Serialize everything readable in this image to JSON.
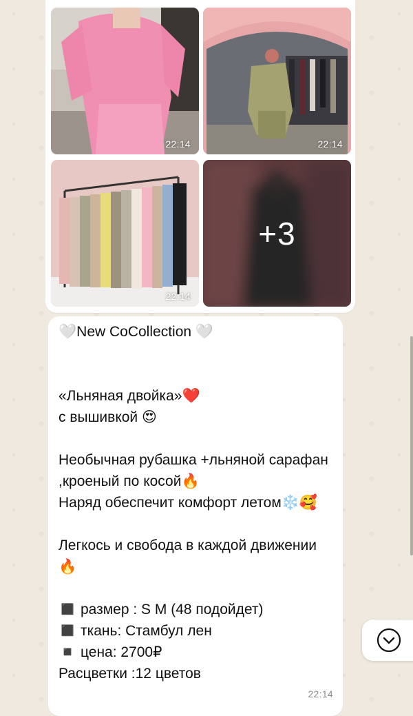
{
  "album": {
    "photos": [
      {
        "name": "pink-linen-set-photo",
        "time": "22:14"
      },
      {
        "name": "olive-linen-set-mirror-photo",
        "time": "22:14"
      },
      {
        "name": "clothing-rack-colors-photo",
        "time": "22:14"
      },
      {
        "name": "more-photos-tile",
        "time": "",
        "more": "+3"
      }
    ]
  },
  "message": {
    "text": "🤍New CoCollection 🤍\n\n\n«Льняная двойка»❤️\nс вышивкой 😍\n\nНеобычная рубашка +льняной сарафан ,кроеный по косой🔥\nНаряд обеспечит комфорт летом❄️🥰\n\nЛегкось и свобода в каждой движении 🔥\n\n◼️ размер : S M (48 подойдет)\n◼️ ткань: Стамбул лен\n◾️ цена: 2700₽\nРасцветки :12 цветов",
    "time": "22:14"
  },
  "icons": {
    "scroll_down": "chevron-down-circle-icon"
  },
  "colors": {
    "chat_background": "#efe9df",
    "bubble": "#ffffff",
    "timestamp": "#8c8c8c"
  }
}
